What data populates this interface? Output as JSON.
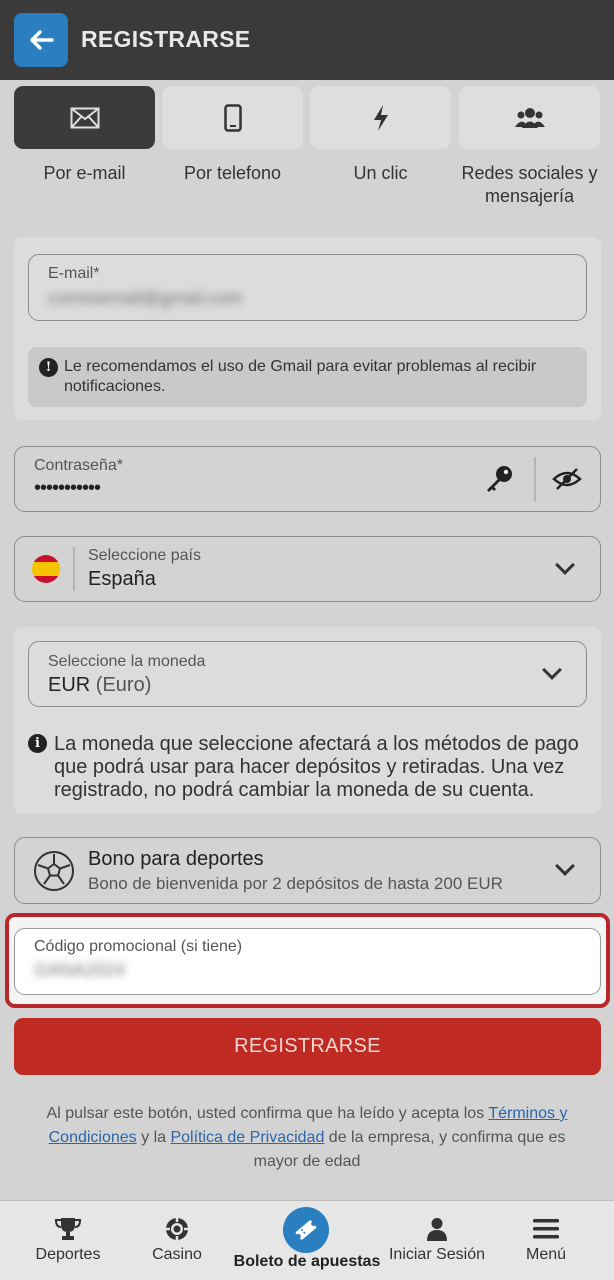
{
  "header": {
    "title": "REGISTRARSE",
    "back_icon": "arrow-left-icon"
  },
  "tabs": [
    {
      "label": "Por e-mail",
      "icon": "envelope-icon",
      "active": true
    },
    {
      "label": "Por telefono",
      "icon": "phone-icon",
      "active": false
    },
    {
      "label": "Un clic",
      "icon": "lightning-icon",
      "active": false
    },
    {
      "label": "Redes sociales y mensajería",
      "icon": "users-icon",
      "active": false
    }
  ],
  "email": {
    "label": "E-mail*",
    "value": "correoemail@gmail.com",
    "notice": "Le recomendamos el uso de Gmail para evitar problemas al recibir notificaciones."
  },
  "password": {
    "label": "Contraseña*",
    "value": "•••••••••••"
  },
  "country": {
    "label": "Seleccione país",
    "value": "España"
  },
  "currency": {
    "label": "Seleccione la moneda",
    "code": "EUR",
    "name": "(Euro)",
    "notice": "La moneda que seleccione afectará a los métodos de pago que podrá usar para hacer depósitos y retiradas. Una vez registrado, no podrá cambiar la moneda de su cuenta."
  },
  "bonus": {
    "title": "Bono para deportes",
    "subtitle": "Bono de bienvenida por 2 depósitos de hasta 200 EUR"
  },
  "promo": {
    "label": "Código promocional (si tiene)",
    "value": "GANA2024"
  },
  "register_button": "REGISTRARSE",
  "legal": {
    "prefix": "Al pulsar este botón, usted confirma que ha leído y acepta los ",
    "terms_link": "Términos y Condiciones",
    "middle": " y la ",
    "privacy_link": "Política de Privacidad",
    "suffix": " de la empresa, y confirma que es mayor de edad"
  },
  "bottom_nav": {
    "sports": "Deportes",
    "casino": "Casino",
    "betslip": "Boleto de apuestas",
    "login": "Iniciar Sesión",
    "menu": "Menú"
  },
  "colors": {
    "accent_blue": "#2a7fc0",
    "register_red": "#bf2b22",
    "highlight_red": "#b8272b",
    "header_dark": "#3a3a3a"
  }
}
